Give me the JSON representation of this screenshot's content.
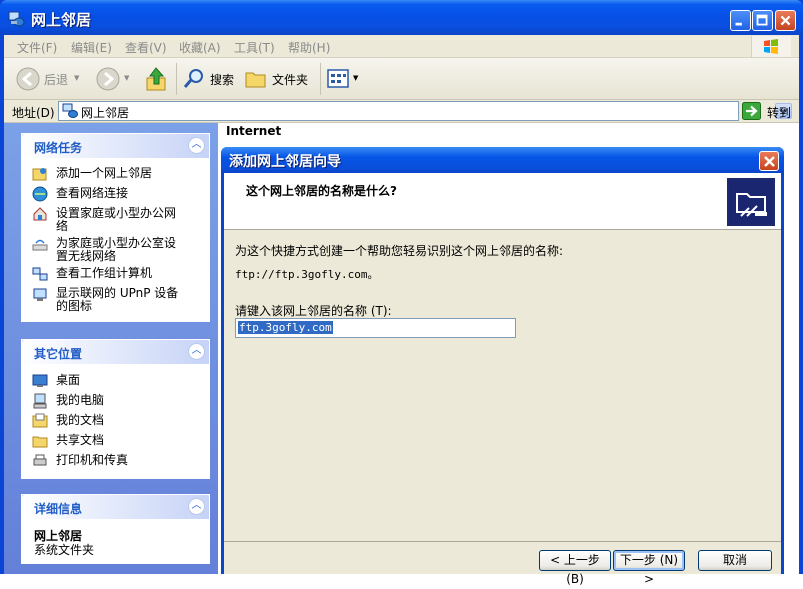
{
  "window": {
    "title": "网上邻居"
  },
  "menu": [
    "文件(F)",
    "编辑(E)",
    "查看(V)",
    "收藏(A)",
    "工具(T)",
    "帮助(H)"
  ],
  "toolbar": {
    "back": "后退",
    "search": "搜索",
    "folders": "文件夹"
  },
  "address": {
    "label": "地址(D)",
    "value": "网上邻居",
    "go": "转到"
  },
  "task_pane": {
    "network_tasks": {
      "title": "网络任务",
      "items": [
        "添加一个网上邻居",
        "查看网络连接",
        "设置家庭或小型办公网络",
        "为家庭或小型办公室设置无线网络",
        "查看工作组计算机",
        "显示联网的 UPnP 设备的图标"
      ]
    },
    "other_places": {
      "title": "其它位置",
      "items": [
        "桌面",
        "我的电脑",
        "我的文档",
        "共享文档",
        "打印机和传真"
      ]
    },
    "details": {
      "title": "详细信息",
      "name": "网上邻居",
      "type": "系统文件夹"
    }
  },
  "main": {
    "column_header": "Internet"
  },
  "wizard": {
    "title": "添加网上邻居向导",
    "question": "这个网上邻居的名称是什么?",
    "description": "为这个快捷方式创建一个帮助您轻易识别这个网上邻居的名称:",
    "url": "ftp://ftp.3gofly.com。",
    "prompt": "请键入该网上邻居的名称 (T):",
    "name_value": "ftp.3gofly.com",
    "back_button": "< 上一步 (B)",
    "next_button": "下一步 (N) >",
    "cancel_button": "取消"
  }
}
